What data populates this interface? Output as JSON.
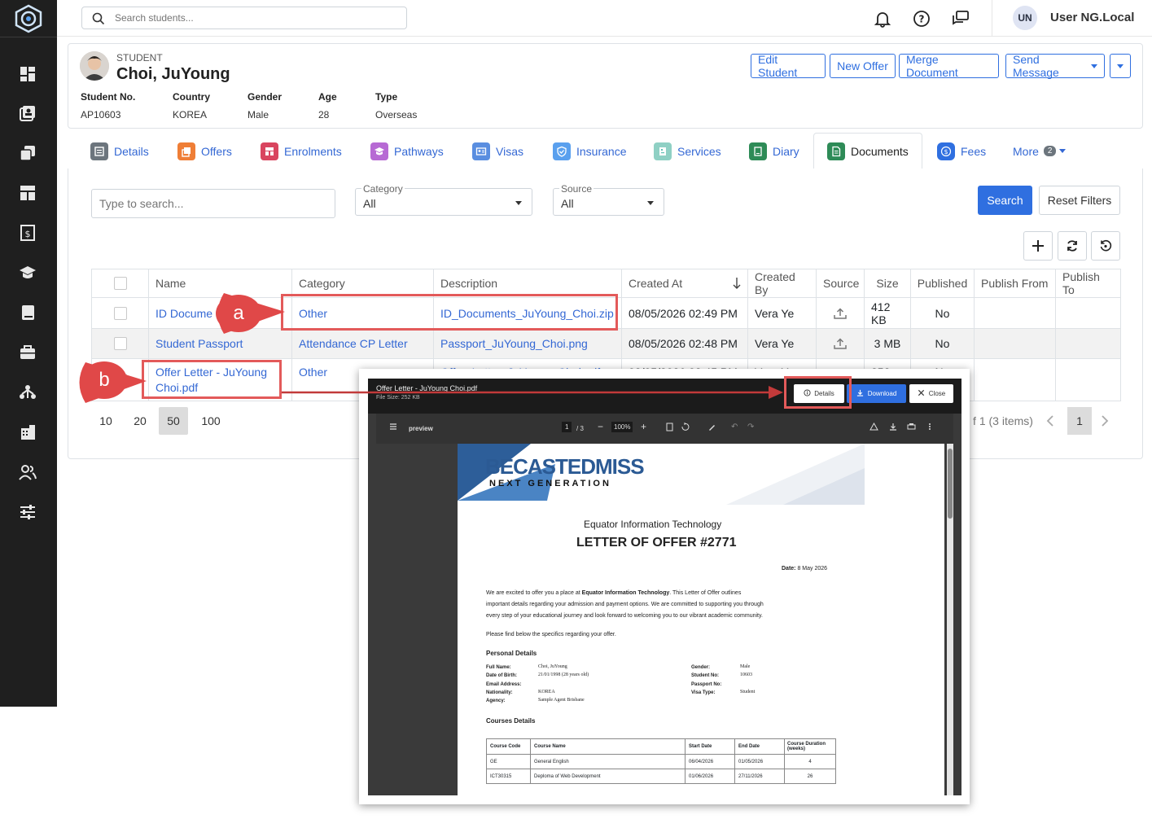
{
  "topbar": {
    "search_placeholder": "Search students...",
    "avatar_initials": "UN",
    "user_name": "User NG.Local"
  },
  "student": {
    "label": "STUDENT",
    "name": "Choi, JuYoung",
    "fields": [
      {
        "key": "Student No.",
        "value": "AP10603"
      },
      {
        "key": "Country",
        "value": "KOREA"
      },
      {
        "key": "Gender",
        "value": "Male"
      },
      {
        "key": "Age",
        "value": "28"
      },
      {
        "key": "Type",
        "value": "Overseas"
      }
    ],
    "buttons": {
      "edit": "Edit Student",
      "new_offer": "New Offer",
      "merge": "Merge Document",
      "send": "Send Message"
    }
  },
  "tabs": [
    {
      "label": "Details",
      "color": "#6c757d"
    },
    {
      "label": "Offers",
      "color": "#ef7e36"
    },
    {
      "label": "Enrolments",
      "color": "#d9455f"
    },
    {
      "label": "Pathways",
      "color": "#b76ad4"
    },
    {
      "label": "Visas",
      "color": "#5a8ee0"
    },
    {
      "label": "Insurance",
      "color": "#5aa0ee"
    },
    {
      "label": "Services",
      "color": "#62c1b5"
    },
    {
      "label": "Diary",
      "color": "#2e8b57"
    },
    {
      "label": "Documents",
      "color": "#2e8b57"
    },
    {
      "label": "Fees",
      "color": "#2f6fe0"
    }
  ],
  "more": {
    "label": "More",
    "badge": "2"
  },
  "filters": {
    "search_placeholder": "Type to search...",
    "category_label": "Category",
    "category_value": "All",
    "source_label": "Source",
    "source_value": "All",
    "search_btn": "Search",
    "reset_btn": "Reset Filters"
  },
  "table": {
    "headers": [
      "Name",
      "Category",
      "Description",
      "Created At",
      "Created By",
      "Source",
      "Size",
      "Published",
      "Publish From",
      "Publish To"
    ],
    "rows": [
      {
        "name": "ID Docume",
        "category": "Other",
        "description": "ID_Documents_JuYoung_Choi.zip",
        "created_at": "08/05/2026 02:49 PM",
        "created_by": "Vera Ye",
        "size": "412 KB",
        "published": "No"
      },
      {
        "name": "Student Passport",
        "category": "Attendance CP Letter",
        "description": "Passport_JuYoung_Choi.png",
        "created_at": "08/05/2026 02:48 PM",
        "created_by": "Vera Ye",
        "size": "3 MB",
        "published": "No"
      },
      {
        "name": "Offer Letter - JuYoung Choi.pdf",
        "category": "Other",
        "description": "Offer_Letter_JuYoung_Choi.pdf",
        "created_at": "08/05/2026 02:45 PM",
        "created_by": "Vera Ye",
        "size": "252 KB",
        "published": "No"
      }
    ]
  },
  "pager": {
    "sizes": [
      "10",
      "20",
      "50",
      "100"
    ],
    "selected": "50",
    "summary": "f 1 (3 items)",
    "page": "1"
  },
  "callouts": {
    "a": "a",
    "b": "b"
  },
  "modal": {
    "title": "Offer Letter - JuYoung Choi.pdf",
    "filesize": "File Size: 252 KB",
    "details_btn": "Details",
    "download_btn": "Download",
    "close_btn": "Close",
    "viewer_name": "preview",
    "page_num": "1",
    "page_total": "/ 3",
    "zoom": "100%"
  },
  "doc": {
    "brand": "BECASTEDMISS",
    "brand_sub": "NEXT GENERATION",
    "org": "Equator Information Technology",
    "heading": "LETTER OF OFFER #2771",
    "date_label": "Date:",
    "date_value": "8 May 2026",
    "para1_a": "We are excited to offer you a place at ",
    "para1_b": "Equator Information Technology",
    "para1_c": ". This Letter of Offer outlines",
    "para1_line2": "important details regarding your admission and payment options. We are committed to supporting you through",
    "para1_line3": "every step of your educational journey and look forward to welcoming you to our vibrant academic community.",
    "para2": "Please find below the specifics regarding your offer.",
    "personal_heading": "Personal Details",
    "personal_left": [
      {
        "k": "Full Name:",
        "v": "Choi, JuYoung"
      },
      {
        "k": "Date of Birth:",
        "v": "21/01/1998 (28 years old)"
      },
      {
        "k": "Email Address:",
        "v": ""
      },
      {
        "k": "Nationality:",
        "v": "KOREA"
      },
      {
        "k": "Agency:",
        "v": "Sample Agent Brisbane"
      }
    ],
    "personal_right": [
      {
        "k": "Gender:",
        "v": "Male"
      },
      {
        "k": "Student No:",
        "v": "10603"
      },
      {
        "k": "Passport No:",
        "v": ""
      },
      {
        "k": "Visa Type:",
        "v": "Student"
      }
    ],
    "courses_heading": "Courses Details",
    "course_headers": [
      "Course Code",
      "Course Name",
      "Start Date",
      "End Date",
      "Course Duration (weeks)"
    ],
    "course_rows": [
      [
        "GE",
        "General English",
        "06/04/2026",
        "01/05/2026",
        "4"
      ],
      [
        "ICT30315",
        "Deploma of Web Development",
        "01/06/2026",
        "27/11/2026",
        "26"
      ]
    ]
  }
}
